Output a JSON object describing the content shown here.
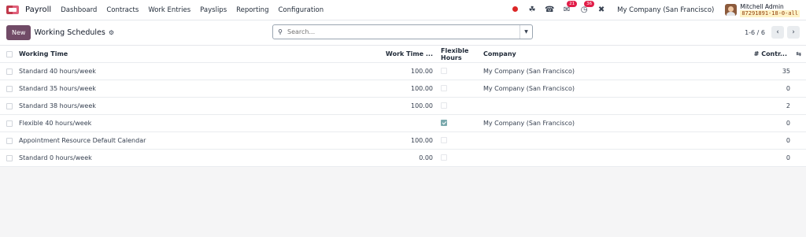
{
  "app": {
    "name": "Payroll"
  },
  "nav": {
    "items": [
      "Dashboard",
      "Contracts",
      "Work Entries",
      "Payslips",
      "Reporting",
      "Configuration"
    ]
  },
  "systray": {
    "messages_count": "21",
    "activity_count": "36",
    "company": "My Company (San Francisco)",
    "user_name": "Mitchell Admin",
    "db_name": "87291891-18-0-all"
  },
  "control": {
    "new_label": "New",
    "title": "Working Schedules",
    "search_placeholder": "Search...",
    "pager": "1-6 / 6"
  },
  "list": {
    "headers": {
      "name": "Working Time",
      "hours": "Work Time ...",
      "flexible": "Flexible Hours",
      "company": "Company",
      "count": "# Contr..."
    },
    "rows": [
      {
        "name": "Standard 40 hours/week",
        "hours": "100.00",
        "flexible": false,
        "company": "My Company (San Francisco)",
        "count": "35"
      },
      {
        "name": "Standard 35 hours/week",
        "hours": "100.00",
        "flexible": false,
        "company": "My Company (San Francisco)",
        "count": "0"
      },
      {
        "name": "Standard 38 hours/week",
        "hours": "100.00",
        "flexible": false,
        "company": "",
        "count": "2"
      },
      {
        "name": "Flexible 40 hours/week",
        "hours": "",
        "flexible": true,
        "company": "My Company (San Francisco)",
        "count": "0"
      },
      {
        "name": "Appointment Resource Default Calendar",
        "hours": "100.00",
        "flexible": false,
        "company": "",
        "count": "0"
      },
      {
        "name": "Standard 0 hours/week",
        "hours": "0.00",
        "flexible": false,
        "company": "",
        "count": "0"
      }
    ]
  },
  "colors": {
    "brand": "#714b67",
    "accent_check": "#7aa9ad",
    "badge": "#e11d48"
  }
}
